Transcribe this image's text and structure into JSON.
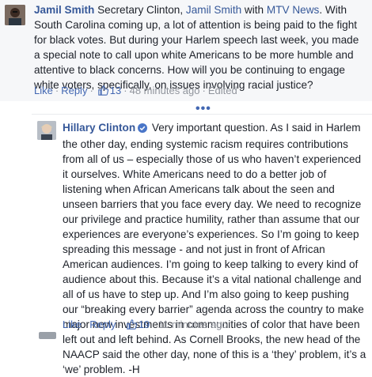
{
  "comment1": {
    "author": "Jamil Smith",
    "text_a": " Secretary Clinton, ",
    "mention1": "Jamil Smith",
    "text_b": " with ",
    "mention2": "MTV News",
    "text_c": ". With South Carolina coming up, a lot of attention is being paid to the fight for black votes. But during your Harlem speech last week, you made a special note to call upon white Americans to be more humble and attentive to black concerns. How will you be continuing to engage white voters, specifically, on issues involving racial justice?",
    "like_label": "Like",
    "reply_label": "Reply",
    "likes": "13",
    "time": "48 minutes ago",
    "edited": "Edited"
  },
  "more_replies": "•••",
  "comment2": {
    "author": "Hillary Clinton",
    "text": " Very important question. As I said in Harlem the other day, ending systemic racism requires contributions from all of us – especially those of us who haven’t experienced it ourselves. White Americans need to do a better job of listening when African Americans talk about the seen and unseen barriers that you face every day. We need to recognize our privilege and practice humility, rather than assume that our experiences are everyone’s experiences. So I’m going to keep spreading this message - and not just in front of African American audiences. I’m going to keep talking to every kind of audience about this. Because it’s a vital national challenge and all of us have to step up. And I’m also going to keep pushing our “breaking every barrier” agenda across the country to make major new investments in communities of color that have been left out and left behind. As Cornell Brooks, the new head of the NAACP said the other day, none of this is a ‘they’ problem, it’s a ‘we’ problem. -H",
    "like_label": "Like",
    "reply_label": "Reply",
    "likes": "19",
    "time": "11 minutes ago"
  },
  "colors": {
    "link": "#365899",
    "action": "#4267b2",
    "meta": "#90949c",
    "highlight_bg": "#f6f7f9"
  },
  "icons": {
    "like": "thumbs-up-icon",
    "verified": "verified-badge-icon",
    "more": "more-replies-icon"
  }
}
